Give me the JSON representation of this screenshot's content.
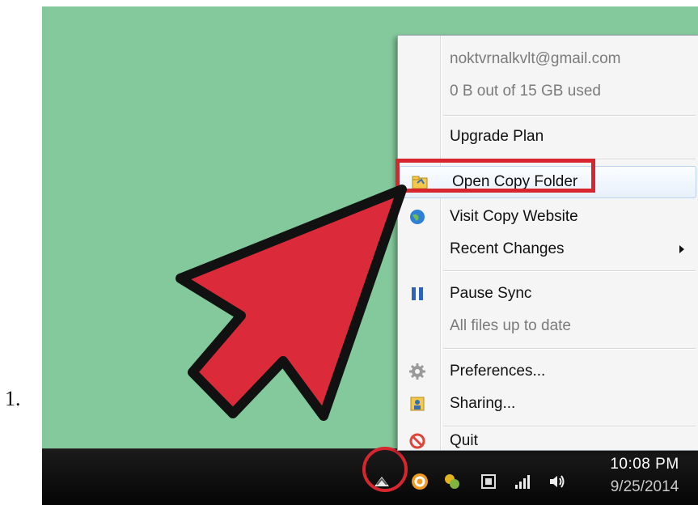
{
  "step": {
    "number": "1."
  },
  "menu": {
    "account_email": "noktvrnalkvlt@gmail.com",
    "usage": "0 B out of 15 GB used",
    "upgrade": "Upgrade Plan",
    "open_folder": "Open Copy Folder",
    "visit_website": "Visit Copy Website",
    "recent_changes": "Recent Changes",
    "pause_sync": "Pause Sync",
    "sync_status": "All files up to date",
    "preferences": "Preferences...",
    "sharing": "Sharing...",
    "quit": "Quit"
  },
  "taskbar": {
    "time": "10:08 PM",
    "date": "9/25/2014",
    "icons": [
      "copy-tray-icon",
      "orange-app-icon",
      "bluetooth-icon",
      "power-icon",
      "signal-icon",
      "volume-icon"
    ]
  },
  "colors": {
    "accent_red": "#d8262f",
    "desktop": "#84c99c",
    "menu_bg": "#f5f5f5"
  }
}
